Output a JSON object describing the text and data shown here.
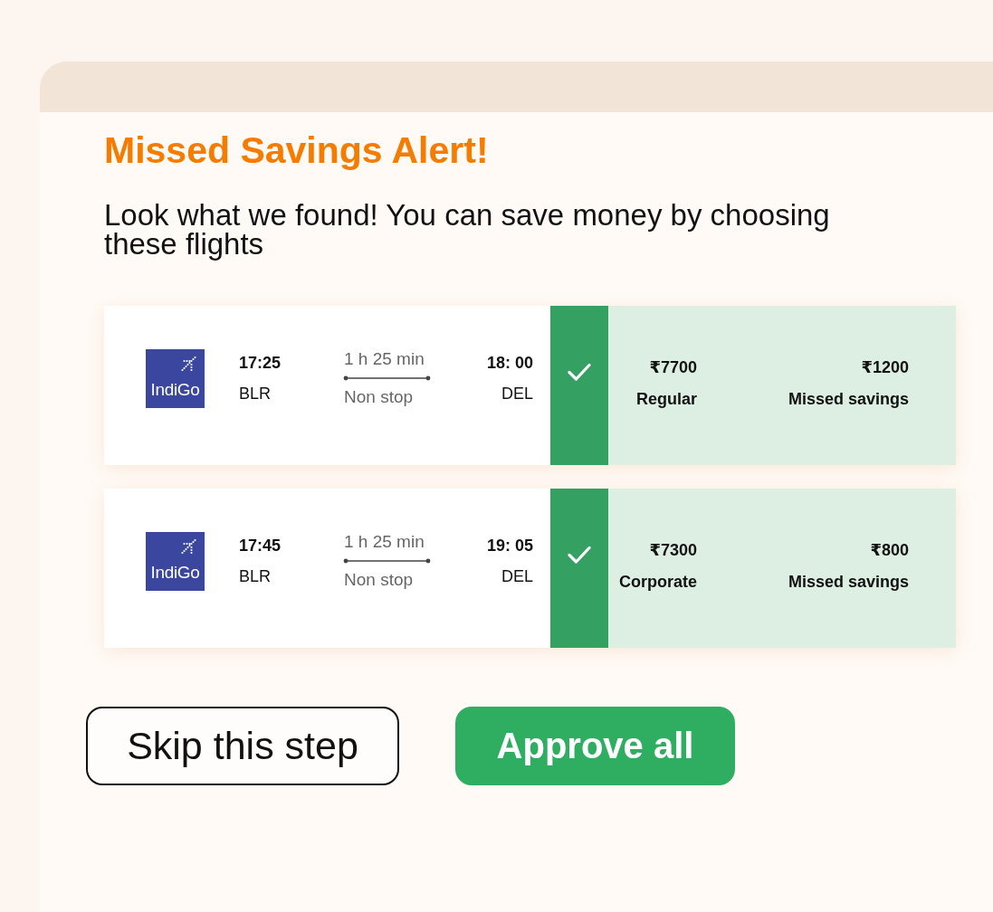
{
  "alert": {
    "title": "Missed Savings Alert!",
    "message": "Look what we found! You can save money by choosing these flights"
  },
  "flights": [
    {
      "logo_text": "IndiGo",
      "departure_time": "17:25",
      "departure_airport": "BLR",
      "duration": "1 h 25 min",
      "stops": "Non stop",
      "arrival_time": "18: 00",
      "arrival_airport": "DEL",
      "selected": true,
      "fare": "₹7700",
      "fare_type": "Regular",
      "missed_savings": "₹1200",
      "missed_savings_label": "Missed savings"
    },
    {
      "logo_text": "IndiGo",
      "departure_time": "17:45",
      "departure_airport": "BLR",
      "duration": "1 h 25 min",
      "stops": "Non stop",
      "arrival_time": "19: 05",
      "arrival_airport": "DEL",
      "selected": true,
      "fare": "₹7300",
      "fare_type": "Corporate",
      "missed_savings": "₹800",
      "missed_savings_label": "Missed savings"
    }
  ],
  "buttons": [
    {
      "label": "Skip this step",
      "kind": "outline"
    },
    {
      "label": "Approve all",
      "kind": "primary"
    }
  ]
}
